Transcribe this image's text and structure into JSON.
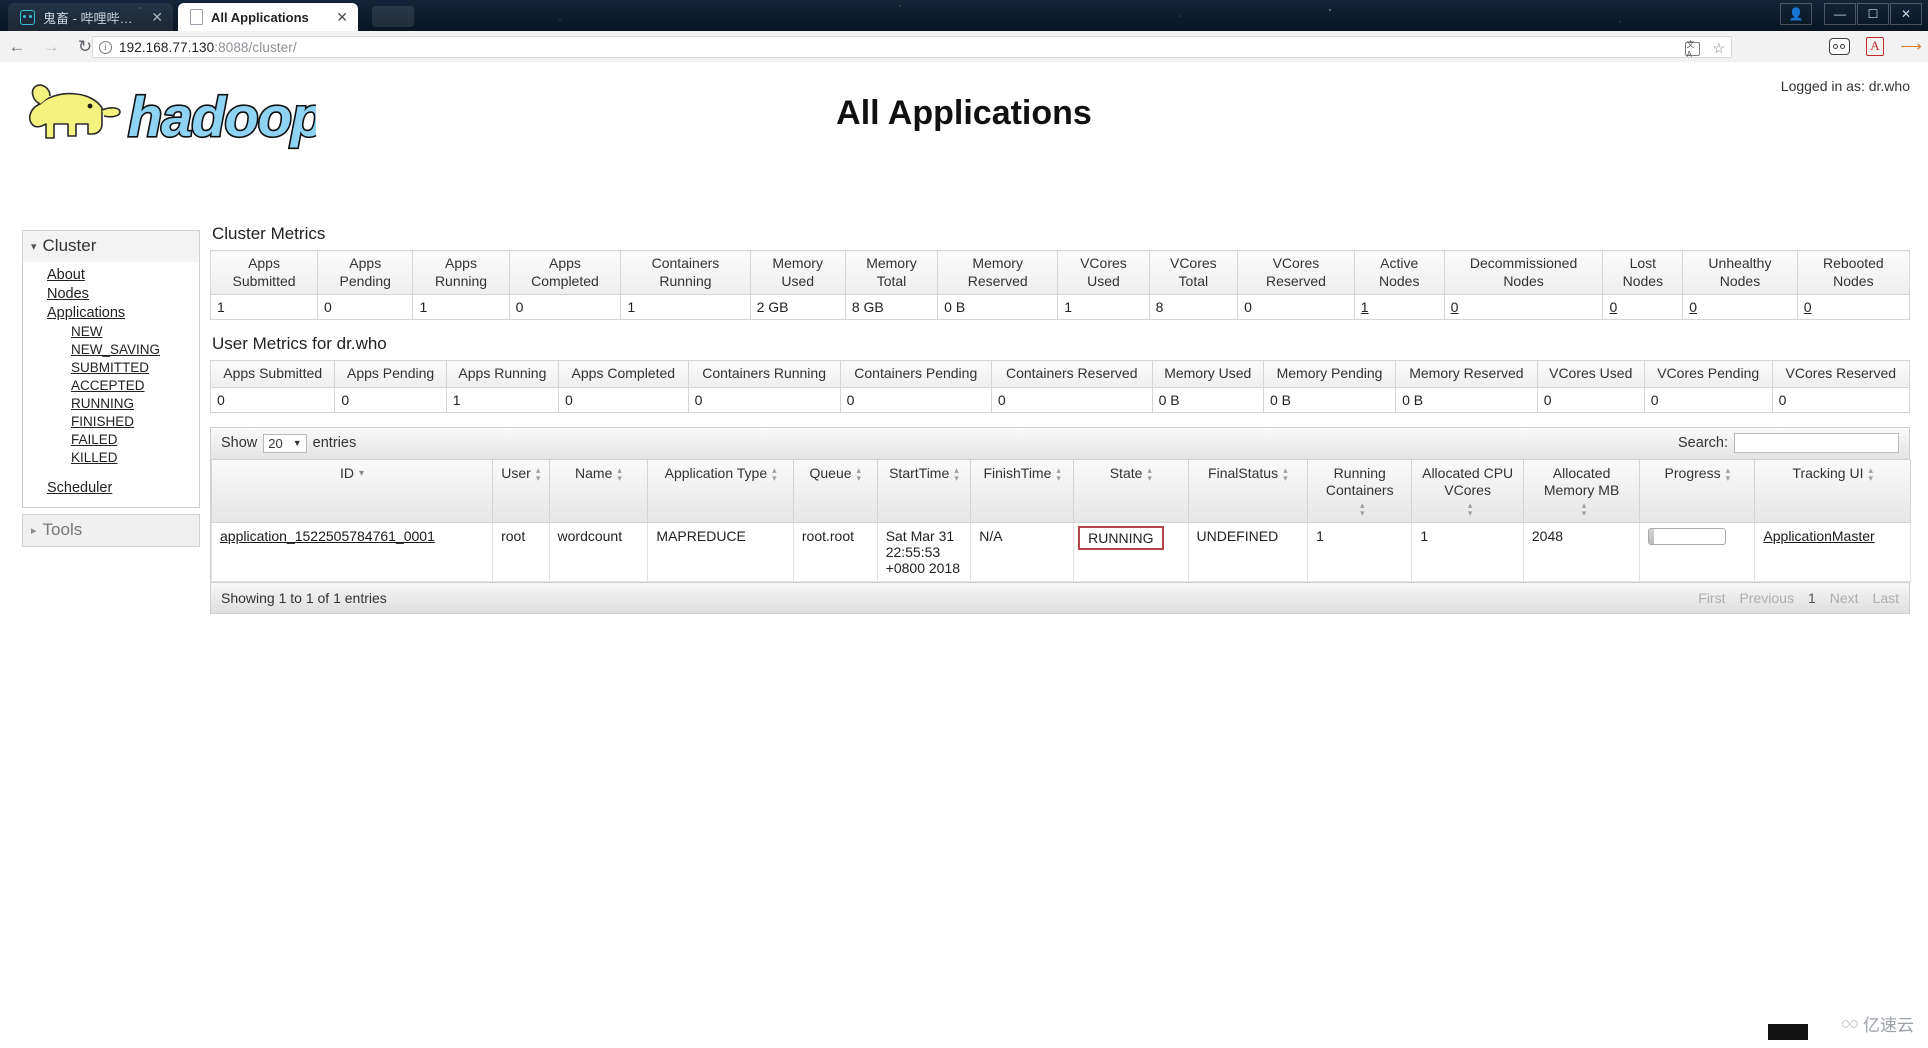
{
  "browser": {
    "tabs": [
      {
        "title": "鬼畜 - 哔哩哔哩 ( ﾟ- ﾟ)つ",
        "icon": "bilibili-favicon",
        "active": false
      },
      {
        "title": "All Applications",
        "icon": "document-favicon",
        "active": true
      }
    ],
    "tab_close_label": "✕",
    "window_controls": {
      "minimize": "—",
      "maximize": "❐",
      "close": "✕",
      "profile": "●"
    },
    "nav": {
      "back": "←",
      "forward": "→",
      "reload": "↻"
    },
    "omnibox": {
      "info_icon": "i",
      "url_host": "192.168.77.130",
      "url_port_path": ":8088/cluster/",
      "star_icon": "☆",
      "translate_icon": "文A"
    },
    "extensions": [
      "oo-extension-icon",
      "adobe-pdf-icon",
      "download-arrow-icon"
    ]
  },
  "header": {
    "logo_alt": "hadoop",
    "logo_text": "hadoop",
    "page_title": "All Applications",
    "logged_in": "Logged in as: dr.who"
  },
  "sidebar": {
    "cluster": {
      "label": "Cluster",
      "expanded": true,
      "items": [
        {
          "label": "About",
          "level": 1
        },
        {
          "label": "Nodes",
          "level": 1
        },
        {
          "label": "Applications",
          "level": 1
        },
        {
          "label": "NEW",
          "level": 2
        },
        {
          "label": "NEW_SAVING",
          "level": 2
        },
        {
          "label": "SUBMITTED",
          "level": 2
        },
        {
          "label": "ACCEPTED",
          "level": 2
        },
        {
          "label": "RUNNING",
          "level": 2
        },
        {
          "label": "FINISHED",
          "level": 2
        },
        {
          "label": "FAILED",
          "level": 2
        },
        {
          "label": "KILLED",
          "level": 2
        },
        {
          "label": "Scheduler",
          "level": 1
        }
      ]
    },
    "tools": {
      "label": "Tools",
      "expanded": false
    }
  },
  "cluster_metrics": {
    "title": "Cluster Metrics",
    "headers": [
      "Apps Submitted",
      "Apps Pending",
      "Apps Running",
      "Apps Completed",
      "Containers Running",
      "Memory Used",
      "Memory Total",
      "Memory Reserved",
      "VCores Used",
      "VCores Total",
      "VCores Reserved",
      "Active Nodes",
      "Decommissioned Nodes",
      "Lost Nodes",
      "Unhealthy Nodes",
      "Rebooted Nodes"
    ],
    "values": [
      "1",
      "0",
      "1",
      "0",
      "1",
      "2 GB",
      "8 GB",
      "0 B",
      "1",
      "8",
      "0",
      "1",
      "0",
      "0",
      "0",
      "0"
    ],
    "link_columns": [
      11,
      12,
      13,
      14,
      15
    ]
  },
  "user_metrics": {
    "title": "User Metrics for dr.who",
    "headers": [
      "Apps Submitted",
      "Apps Pending",
      "Apps Running",
      "Apps Completed",
      "Containers Running",
      "Containers Pending",
      "Containers Reserved",
      "Memory Used",
      "Memory Pending",
      "Memory Reserved",
      "VCores Used",
      "VCores Pending",
      "VCores Reserved"
    ],
    "values": [
      "0",
      "0",
      "1",
      "0",
      "0",
      "0",
      "0",
      "0 B",
      "0 B",
      "0 B",
      "0",
      "0",
      "0"
    ]
  },
  "datatable": {
    "show_label": "Show",
    "entries_label": "entries",
    "page_size": "20",
    "search_label": "Search:",
    "search_value": "",
    "columns": [
      {
        "label": "ID",
        "sort": "desc"
      },
      {
        "label": "User",
        "sort": "both"
      },
      {
        "label": "Name",
        "sort": "both"
      },
      {
        "label": "Application Type",
        "sort": "both"
      },
      {
        "label": "Queue",
        "sort": "both"
      },
      {
        "label": "StartTime",
        "sort": "both"
      },
      {
        "label": "FinishTime",
        "sort": "both"
      },
      {
        "label": "State",
        "sort": "both"
      },
      {
        "label": "FinalStatus",
        "sort": "both"
      },
      {
        "label": "Running Containers",
        "sort": "both"
      },
      {
        "label": "Allocated CPU VCores",
        "sort": "both"
      },
      {
        "label": "Allocated Memory MB",
        "sort": "both"
      },
      {
        "label": "Progress",
        "sort": "both"
      },
      {
        "label": "Tracking UI",
        "sort": "both"
      }
    ],
    "rows": [
      {
        "id": "application_1522505784761_0001",
        "user": "root",
        "name": "wordcount",
        "application_type": "MAPREDUCE",
        "queue": "root.root",
        "start_time": "Sat Mar 31 22:55:53 +0800 2018",
        "finish_time": "N/A",
        "state": "RUNNING",
        "final_status": "UNDEFINED",
        "running_containers": "1",
        "allocated_cpu_vcores": "1",
        "allocated_memory_mb": "2048",
        "progress_percent": 6,
        "tracking_ui": "ApplicationMaster"
      }
    ],
    "footer_info": "Showing 1 to 1 of 1 entries",
    "pager": {
      "first": "First",
      "previous": "Previous",
      "current": "1",
      "next": "Next",
      "last": "Last"
    }
  },
  "annotation": {
    "highlight_color": "#b4444b",
    "highlight_target": "RUNNING"
  },
  "watermark": {
    "text": "亿速云",
    "logo": "∞"
  }
}
